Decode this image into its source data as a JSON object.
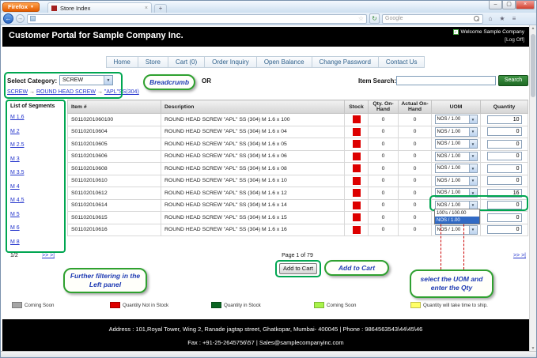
{
  "browser": {
    "app_button": "Firefox",
    "tab_title": "Store Index",
    "search_placeholder": "Google"
  },
  "icons": {
    "back": "←",
    "forward": "→",
    "reload": "↻",
    "dropdown_small": "▼",
    "star": "☆",
    "home": "⌂",
    "menu": "≡",
    "bookmark": "★",
    "close": "×",
    "minimize": "–",
    "maximize": "▢",
    "check": "✓",
    "plus": "+",
    "up": "▲",
    "down": "▼",
    "caret": "▼"
  },
  "header": {
    "title": "Customer Portal  for Sample Company Inc.",
    "welcome": "Welcome Sample Company",
    "logoff": "[Log Off]"
  },
  "nav": {
    "items": [
      "Home",
      "Store",
      "Cart (0)",
      "Order Inquiry",
      "Open Balance",
      "Change Password",
      "Contact Us"
    ]
  },
  "filter": {
    "category_label": "Select Category:",
    "category_value": "SCREW",
    "or_label": "OR",
    "search_label": "Item Search:",
    "search_button": "Search"
  },
  "breadcrumb": {
    "separator": "→",
    "parts": [
      "SCREW",
      "ROUND HEAD SCREW",
      "\"APL\"SS(304)"
    ]
  },
  "segments": {
    "title": "List of Segments",
    "items": [
      "M 1.6",
      "M 2",
      "M 2.5",
      "M 3",
      "M 3.5",
      "M 4",
      "M 4.5",
      "M 5",
      "M 6",
      "M 8"
    ],
    "page_indicator": "1/2",
    "next_links": ">> >|"
  },
  "table": {
    "headers": [
      "Item #",
      "Description",
      "Stock",
      "Qty. On-Hand",
      "Actual On-Hand",
      "UOM",
      "Quantity"
    ],
    "rows": [
      {
        "item": "S0110201060100",
        "desc": "ROUND HEAD SCREW \"APL\" SS (304) M 1.6 x 100",
        "stock": "red",
        "qty_on_hand": "0",
        "actual_on_hand": "0",
        "uom": "NOS / 1.00",
        "quantity": "10"
      },
      {
        "item": "S01102010604",
        "desc": "ROUND HEAD SCREW \"APL\" SS (304) M 1.6 x 04",
        "stock": "red",
        "qty_on_hand": "0",
        "actual_on_hand": "0",
        "uom": "NOS / 1.00",
        "quantity": "0"
      },
      {
        "item": "S01102010605",
        "desc": "ROUND HEAD SCREW \"APL\" SS (304) M 1.6 x 05",
        "stock": "red",
        "qty_on_hand": "0",
        "actual_on_hand": "0",
        "uom": "NOS / 1.00",
        "quantity": "0"
      },
      {
        "item": "S01102010606",
        "desc": "ROUND HEAD SCREW \"APL\" SS (304) M 1.6 x 06",
        "stock": "red",
        "qty_on_hand": "0",
        "actual_on_hand": "0",
        "uom": "NOS / 1.00",
        "quantity": "0"
      },
      {
        "item": "S01102010608",
        "desc": "ROUND HEAD SCREW \"APL\" SS (304) M 1.6 x 08",
        "stock": "red",
        "qty_on_hand": "0",
        "actual_on_hand": "0",
        "uom": "NOS / 1.00",
        "quantity": "0"
      },
      {
        "item": "S01102010610",
        "desc": "ROUND HEAD SCREW \"APL\" SS (304) M 1.6 x 10",
        "stock": "red",
        "qty_on_hand": "0",
        "actual_on_hand": "0",
        "uom": "NOS / 1.00",
        "quantity": "0"
      },
      {
        "item": "S01102010612",
        "desc": "ROUND HEAD SCREW \"APL\" SS (304) M 1.6 x 12",
        "stock": "red",
        "qty_on_hand": "0",
        "actual_on_hand": "0",
        "uom": "NOS / 1.00",
        "quantity": "16",
        "uom_open": true
      },
      {
        "item": "S01102010614",
        "desc": "ROUND HEAD SCREW \"APL\" SS (304) M 1.6 x 14",
        "stock": "red",
        "qty_on_hand": "0",
        "actual_on_hand": "0",
        "uom": "NOS / 1.00",
        "quantity": "0"
      },
      {
        "item": "S01102010615",
        "desc": "ROUND HEAD SCREW \"APL\" SS (304) M 1.6 x 15",
        "stock": "red",
        "qty_on_hand": "0",
        "actual_on_hand": "0",
        "uom": "NOS / 1.00",
        "quantity": "0"
      },
      {
        "item": "S01102010616",
        "desc": "ROUND HEAD SCREW \"APL\" SS (304) M 1.6 x 16",
        "stock": "red",
        "qty_on_hand": "0",
        "actual_on_hand": "0",
        "uom": "NOS / 1.00",
        "quantity": "0"
      }
    ]
  },
  "uom_dropdown": {
    "options": [
      "100's / 100.00",
      "NOS / 1.00"
    ],
    "highlighted_index": 1
  },
  "pagination": {
    "page_info": "Page 1 of 79",
    "next_links": ">> >|"
  },
  "add_to_cart": {
    "button_label": "Add to Cart"
  },
  "callouts": {
    "breadcrumb": "Breadcrumb",
    "filtering": "Further  filtering in the Left panel",
    "add_to_cart": "Add to Cart",
    "uom": "select the UOM and enter the Qty"
  },
  "legend": {
    "items": [
      {
        "color": "#a6a6a6",
        "label": "Coming Soon"
      },
      {
        "color": "#dd0000",
        "label": "Quantity Not in Stock"
      },
      {
        "color": "#0b6623",
        "label": "Quantity in Stock"
      },
      {
        "color": "#a8f34a",
        "label": "Coming Soon"
      },
      {
        "color": "#ffff66",
        "label": "Quantity will take time to ship."
      }
    ]
  },
  "colors": {
    "accent_green": "#00a651",
    "stock_red": "#dd0000",
    "link_blue": "#2233cc",
    "callout_text": "#1f3bb3",
    "search_button_green": "#1f6a24"
  },
  "footer": {
    "line1": "Address : 101,Royal Tower, Wing 2, Ranade jagtap street, Ghatkopar, Mumbai- 400045 | Phone : 9864563543\\44\\45\\46",
    "line2": "Fax : +91-25-2645756\\57 | Sales@samplecompanyinc.com"
  }
}
